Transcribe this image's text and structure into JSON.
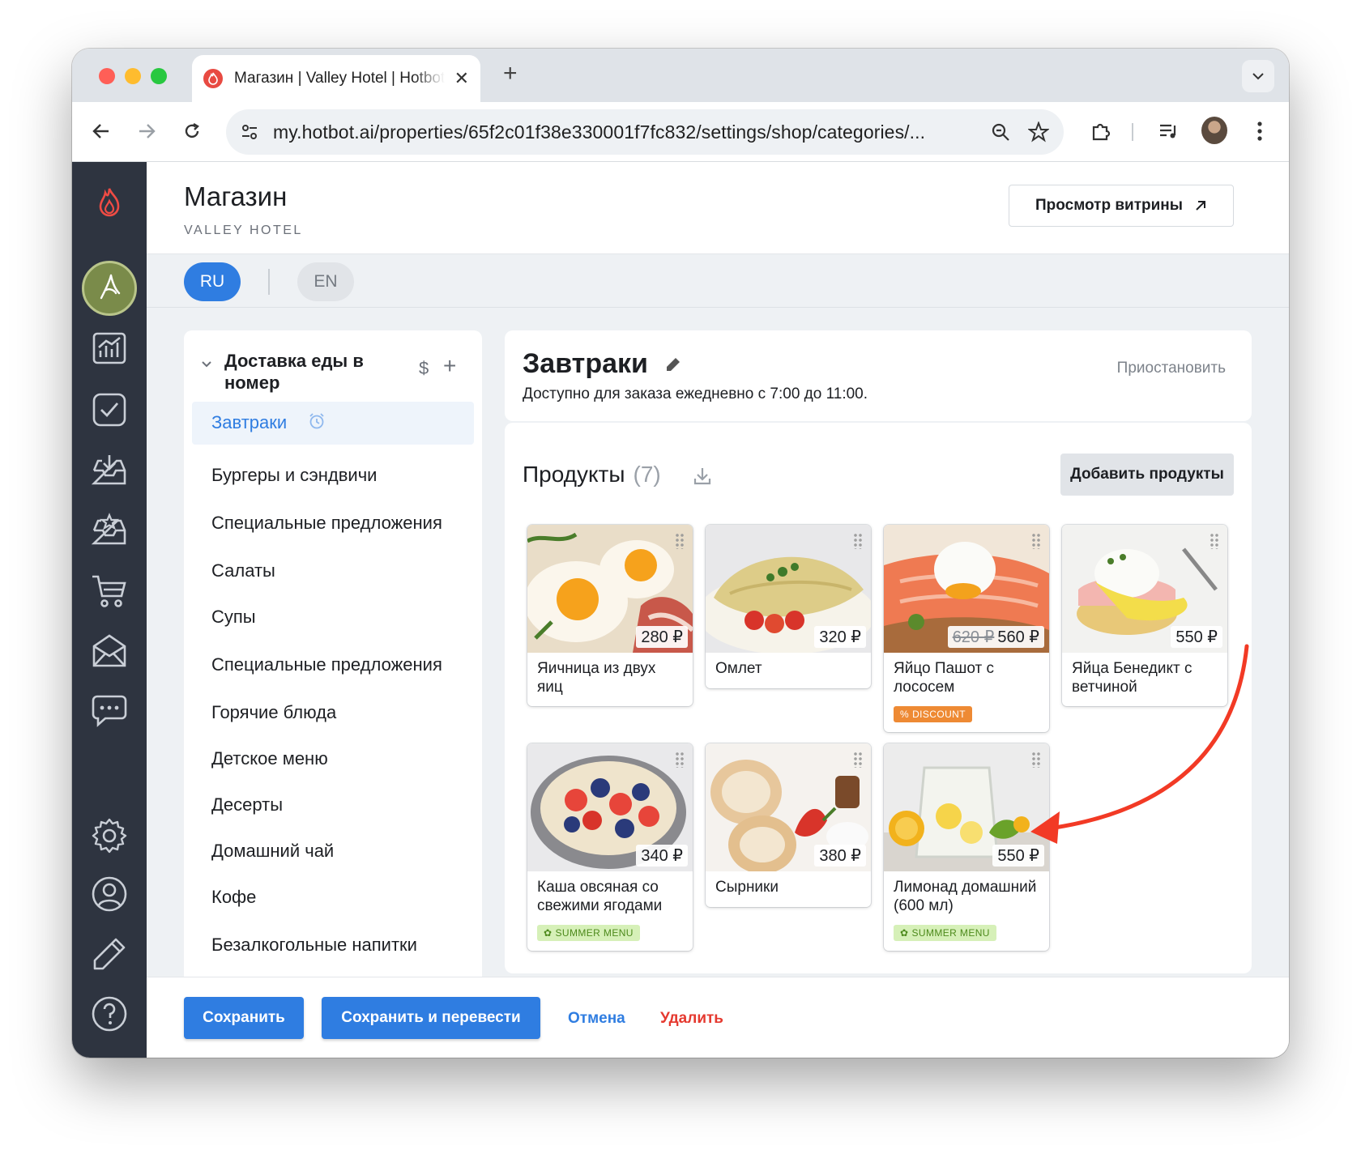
{
  "browser": {
    "tab_title": "Магазин | Valley Hotel | Hotbot",
    "url": "my.hotbot.ai/properties/65f2c01f38e330001f7fc832/settings/shop/categories/..."
  },
  "header": {
    "title": "Магазин",
    "subtitle": "VALLEY HOTEL",
    "preview_button": "Просмотр витрины"
  },
  "languages": {
    "active": "RU",
    "other": "EN"
  },
  "categories": {
    "group_title": "Доставка еды в номер",
    "items": [
      "Завтраки",
      "Бургеры и сэндвичи",
      "Специальные предложения",
      "Салаты",
      "Супы",
      "Специальные предложения",
      "Горячие блюда",
      "Детское меню",
      "Десерты",
      "Домашний чай",
      "Кофе",
      "Безалкогольные напитки"
    ]
  },
  "category": {
    "title": "Завтраки",
    "description": "Доступно для заказа ежедневно с 7:00 до 11:00.",
    "pause_label": "Приостановить"
  },
  "products": {
    "title": "Продукты",
    "count": "(7)",
    "add_button": "Добавить продукты",
    "items": [
      {
        "name": "Яичница из двух яиц",
        "price": "280 ₽"
      },
      {
        "name": "Омлет",
        "price": "320 ₽"
      },
      {
        "name": "Яйцо Пашот с лососем",
        "old_price": "620 ₽",
        "price": "560 ₽",
        "badge": "DISCOUNT"
      },
      {
        "name": "Яйца Бенедикт с ветчиной",
        "price": "550 ₽"
      },
      {
        "name": "Каша овсяная со свежими ягодами",
        "price": "340 ₽",
        "badge": "SUMMER MENU"
      },
      {
        "name": "Сырники",
        "price": "380 ₽"
      },
      {
        "name": "Лимонад домашний (600 мл)",
        "price": "550 ₽",
        "badge": "SUMMER MENU"
      }
    ]
  },
  "footer": {
    "save": "Сохранить",
    "save_translate": "Сохранить и перевести",
    "cancel": "Отмена",
    "delete": "Удалить"
  },
  "colors": {
    "accent": "#2f7de1",
    "sidebar": "#2e3440",
    "danger": "#e5392f",
    "discount": "#ee8a34",
    "summer": "#d6f0b8",
    "annotation_arrow": "#f23a25"
  }
}
